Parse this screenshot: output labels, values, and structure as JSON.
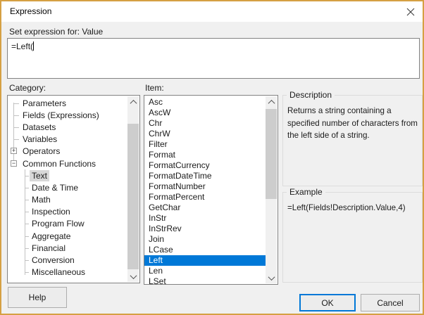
{
  "dialog": {
    "title": "Expression",
    "set_expression_for": "Set expression for: Value",
    "expression_value": "=Left(",
    "category_label": "Category:",
    "item_label": "Item:",
    "colors": {
      "window_border": "#D5A043",
      "selection": "#0078D7",
      "inactive_selection": "#D8D8D8"
    }
  },
  "category_tree": {
    "glyphs": {
      "plus": "+",
      "minus": "−"
    },
    "items": [
      {
        "label": "Parameters",
        "level": 0
      },
      {
        "label": "Fields (Expressions)",
        "level": 0
      },
      {
        "label": "Datasets",
        "level": 0
      },
      {
        "label": "Variables",
        "level": 0
      },
      {
        "label": "Operators",
        "level": 0,
        "glyph": "plus"
      },
      {
        "label": "Common Functions",
        "level": 0,
        "glyph": "minus"
      },
      {
        "label": "Text",
        "level": 1,
        "selected": true
      },
      {
        "label": "Date & Time",
        "level": 1
      },
      {
        "label": "Math",
        "level": 1
      },
      {
        "label": "Inspection",
        "level": 1
      },
      {
        "label": "Program Flow",
        "level": 1
      },
      {
        "label": "Aggregate",
        "level": 1
      },
      {
        "label": "Financial",
        "level": 1
      },
      {
        "label": "Conversion",
        "level": 1
      },
      {
        "label": "Miscellaneous",
        "level": 1
      }
    ]
  },
  "item_list": {
    "items": [
      "Asc",
      "AscW",
      "Chr",
      "ChrW",
      "Filter",
      "Format",
      "FormatCurrency",
      "FormatDateTime",
      "FormatNumber",
      "FormatPercent",
      "GetChar",
      "InStr",
      "InStrRev",
      "Join",
      "LCase",
      "Left",
      "Len",
      "LSet"
    ],
    "selected": "Left"
  },
  "description": {
    "heading": "Description",
    "text": "Returns a string containing a specified number of characters from the left side of a string."
  },
  "example": {
    "heading": "Example",
    "code": "=Left(Fields!Description.Value,4)"
  },
  "buttons": {
    "help": "Help",
    "ok": "OK",
    "cancel": "Cancel"
  }
}
